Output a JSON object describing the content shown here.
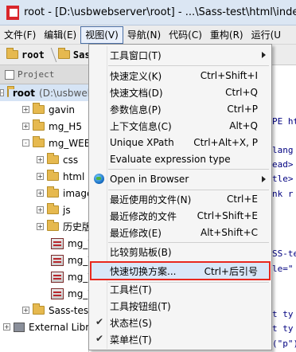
{
  "window": {
    "title": "root - [D:\\usbwebserver\\root] - ...\\Sass-test\\html\\index.htm"
  },
  "menubar": [
    {
      "label": "文件(F)"
    },
    {
      "label": "编辑(E)"
    },
    {
      "label": "视图(V)",
      "active": true
    },
    {
      "label": "导航(N)"
    },
    {
      "label": "代码(C)"
    },
    {
      "label": "重构(R)"
    },
    {
      "label": "运行(U"
    }
  ],
  "breadcrumb": {
    "root": "root",
    "next": "Sass"
  },
  "project_pane": {
    "title": "Project"
  },
  "tree": [
    {
      "label": "root",
      "suffix": "(D:\\usbwebserver\\root)",
      "expander": "-",
      "indent": 4
    },
    {
      "label": "gavin",
      "expander": "+",
      "indent": 28
    },
    {
      "label": "mg_H5",
      "expander": "+",
      "indent": 28
    },
    {
      "label": "mg_WEB",
      "expander": "-",
      "indent": 28
    },
    {
      "label": "css",
      "expander": "+",
      "indent": 46
    },
    {
      "label": "html",
      "expander": "+",
      "indent": 46
    },
    {
      "label": "images",
      "expander": "+",
      "indent": 46
    },
    {
      "label": "js",
      "expander": "+",
      "indent": 46
    },
    {
      "label": "历史版本",
      "expander": "+",
      "indent": 46
    },
    {
      "label": "mg_WEB1",
      "expander": "",
      "indent": 64,
      "file": true
    },
    {
      "label": "mg_WEB2",
      "expander": "",
      "indent": 64,
      "file": true
    },
    {
      "label": "mg_WEB3",
      "expander": "",
      "indent": 64,
      "file": true
    },
    {
      "label": "mg_WEB4",
      "expander": "",
      "indent": 64,
      "file": true
    },
    {
      "label": "Sass-test",
      "expander": "+",
      "indent": 28
    },
    {
      "label": "External Libraries",
      "expander": "+",
      "indent": 4,
      "lib": true
    }
  ],
  "editor_fragments": [
    "PE ht",
    "lang",
    "ead>",
    "tle>",
    "nk r",
    "SS-te",
    "le=\"",
    "t ty",
    "t ty",
    "(\"p\")"
  ],
  "view_menu": {
    "items": [
      {
        "label": "工具窗口(T)",
        "shortcut": "",
        "submenu": true
      },
      {
        "label": "快速定义(K)",
        "shortcut": "Ctrl+Shift+I"
      },
      {
        "label": "快速文档(D)",
        "shortcut": "Ctrl+Q"
      },
      {
        "label": "参数信息(P)",
        "shortcut": "Ctrl+P"
      },
      {
        "label": "上下文信息(C)",
        "shortcut": "Alt+Q"
      },
      {
        "label": "Unique XPath",
        "shortcut": "Ctrl+Alt+X, P"
      },
      {
        "label": "Evaluate expression type",
        "shortcut": ""
      },
      {
        "label": "Open in Browser",
        "shortcut": "",
        "submenu": true,
        "icon": "globe-icon"
      },
      {
        "label": "最近使用的文件(N)",
        "shortcut": "Ctrl+E"
      },
      {
        "label": "最近修改的文件",
        "shortcut": "Ctrl+Shift+E"
      },
      {
        "label": "最近修改(E)",
        "shortcut": "Alt+Shift+C"
      },
      {
        "label": "比较剪贴板(B)",
        "shortcut": ""
      },
      {
        "label": "快速切换方案...",
        "shortcut": "Ctrl+后引号",
        "highlighted": true
      },
      {
        "label": "工具栏(T)",
        "shortcut": ""
      },
      {
        "label": "工具按钮组(T)",
        "shortcut": ""
      },
      {
        "label": "状态栏(S)",
        "shortcut": "",
        "checked": true
      },
      {
        "label": "菜单栏(T)",
        "shortcut": "",
        "checked": true
      }
    ]
  },
  "colors": {
    "highlight_border": "#e8281e",
    "menu_bg": "#f5f5f5",
    "title_bg": "#dbe6f3"
  }
}
